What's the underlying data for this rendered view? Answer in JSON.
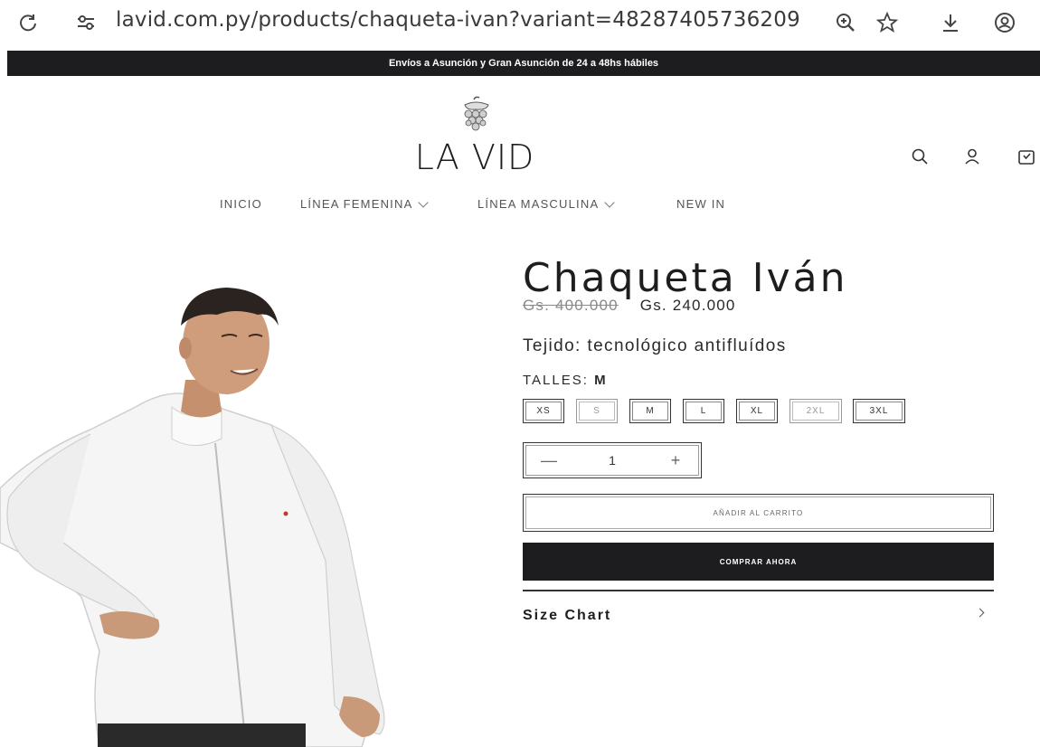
{
  "browser": {
    "url": "lavid.com.py/products/chaqueta-ivan?variant=48287405736209",
    "icons": [
      "reload-icon",
      "site-info-icon",
      "zoom-icon",
      "bookmark-star-icon",
      "download-icon",
      "profile-icon"
    ]
  },
  "announcement": "Envíos a Asunción y Gran Asunción de 24 a 48hs hábiles",
  "header": {
    "logo_text": "LA VID",
    "icons": [
      "search-icon",
      "account-icon",
      "cart-icon"
    ]
  },
  "nav": [
    {
      "label": "INICIO",
      "has_dropdown": false
    },
    {
      "label": "LÍNEA FEMENINA",
      "has_dropdown": true
    },
    {
      "label": "LÍNEA MASCULINA",
      "has_dropdown": true
    },
    {
      "label": "NEW IN",
      "has_dropdown": false
    }
  ],
  "product": {
    "title": "Chaqueta Iván",
    "price_old": "Gs. 400.000",
    "price_new": "Gs. 240.000",
    "fabric": "Tejido: tecnológico antifluídos",
    "size_label": "TALLES:",
    "size_selected": "M",
    "sizes": [
      {
        "label": "XS",
        "available": true
      },
      {
        "label": "S",
        "available": false
      },
      {
        "label": "M",
        "available": true
      },
      {
        "label": "L",
        "available": true
      },
      {
        "label": "XL",
        "available": true
      },
      {
        "label": "2XL",
        "available": false
      },
      {
        "label": "3XL",
        "available": true
      }
    ],
    "quantity": "1",
    "qty_minus": "—",
    "qty_plus": "+",
    "add_to_cart": "AÑADIR AL CARRITO",
    "buy_now": "COMPRAR AHORA",
    "size_chart": "Size Chart"
  },
  "colors": {
    "dark": "#1d1d1f",
    "text": "#1e1e1e",
    "muted": "#8a8a8a"
  }
}
